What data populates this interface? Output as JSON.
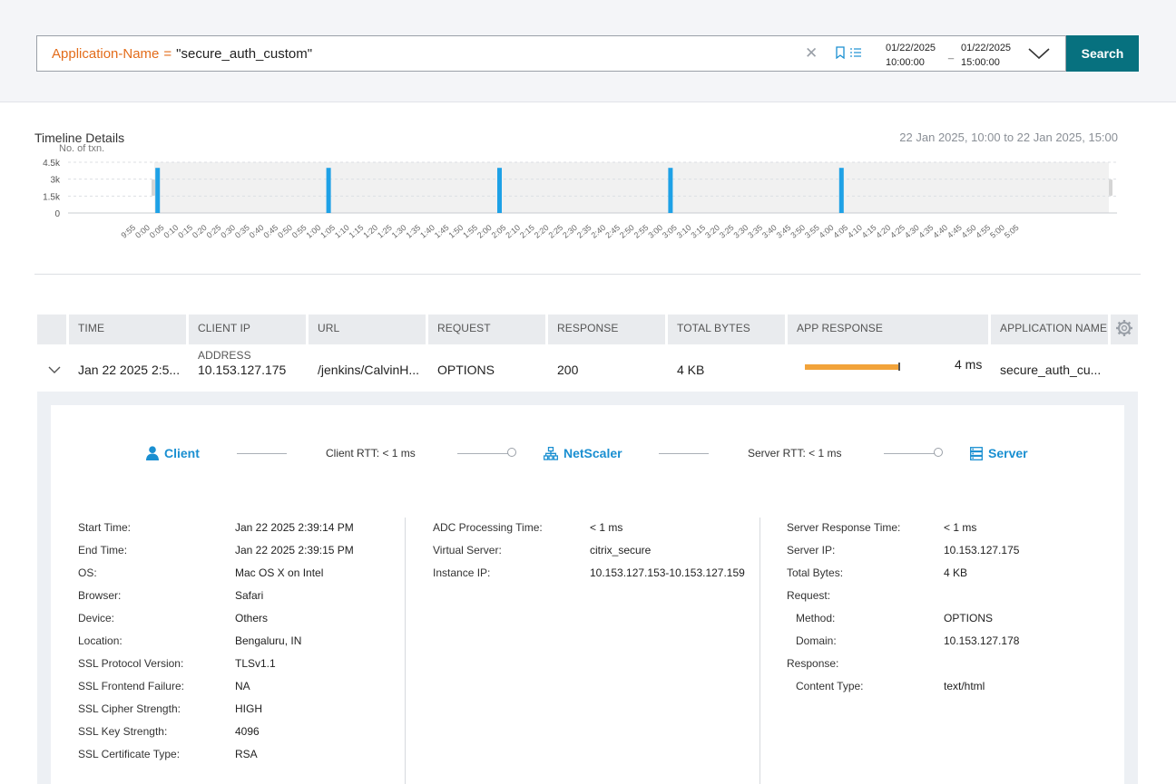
{
  "search": {
    "query_key": "Application-Name",
    "query_op": "=",
    "query_value": "\"secure_auth_custom\"",
    "clear_icon": "close-icon",
    "bookmark_icon": "bookmark-icon",
    "list_icon": "list-icon"
  },
  "date_range": {
    "from_date": "01/22/2025",
    "from_time": "10:00:00",
    "separator": "_",
    "to_date": "01/22/2025",
    "to_time": "15:00:00"
  },
  "search_button": "Search",
  "timeline": {
    "title": "Timeline Details",
    "range_label": "22 Jan 2025, 10:00 to 22 Jan 2025, 15:00"
  },
  "chart_data": {
    "type": "bar",
    "ylabel": "No. of txn.",
    "yticks": [
      "4.5k",
      "3k",
      "1.5k",
      "0"
    ],
    "ylim": [
      0,
      4500
    ],
    "xticks": [
      "9:55",
      "0:00",
      "0:05",
      "0:10",
      "0:15",
      "0:20",
      "0:25",
      "0:30",
      "0:35",
      "0:40",
      "0:45",
      "0:50",
      "0:55",
      "1:00",
      "1:05",
      "1:10",
      "1:15",
      "1:20",
      "1:25",
      "1:30",
      "1:35",
      "1:40",
      "1:45",
      "1:50",
      "1:55",
      "2:00",
      "2:05",
      "2:10",
      "2:15",
      "2:20",
      "2:25",
      "2:30",
      "2:35",
      "2:40",
      "2:45",
      "2:50",
      "2:55",
      "3:00",
      "3:05",
      "3:10",
      "3:15",
      "3:20",
      "3:25",
      "3:30",
      "3:35",
      "3:40",
      "3:45",
      "3:50",
      "3:55",
      "4:00",
      "4:05",
      "4:10",
      "4:15",
      "4:20",
      "4:25",
      "4:30",
      "4:35",
      "4:40",
      "4:45",
      "4:50",
      "4:55",
      "5:00",
      "5:05"
    ],
    "bars": [
      {
        "x": "10:00",
        "value": 4000
      },
      {
        "x": "11:00",
        "value": 4000
      },
      {
        "x": "12:00",
        "value": 4000
      },
      {
        "x": "13:00",
        "value": 4000
      },
      {
        "x": "14:00",
        "value": 4000
      }
    ],
    "color": "#1ea1e6",
    "grid": true
  },
  "table": {
    "columns": [
      "TIME",
      "CLIENT IP ADDRESS",
      "URL",
      "REQUEST",
      "RESPONSE",
      "TOTAL BYTES",
      "APP RESPONSE",
      "APPLICATION NAME"
    ],
    "settings_icon": "gear-icon",
    "row": {
      "time": "Jan 22 2025 2:5...",
      "client_ip": "10.153.127.175",
      "url": "/jenkins/CalvinH...",
      "request": "OPTIONS",
      "response": "200",
      "total_bytes": "4 KB",
      "app_response_ms": "4 ms",
      "app_response_fill": 1.0,
      "application_name": "secure_auth_cu...",
      "bar_color": "#f2a33a"
    }
  },
  "flow": {
    "client": "Client",
    "client_rtt": "Client RTT: < 1 ms",
    "netscaler": "NetScaler",
    "server_rtt": "Server RTT: < 1 ms",
    "server": "Server",
    "client_icon": "user-icon",
    "netscaler_icon": "network-icon",
    "server_icon": "server-icon"
  },
  "client_details": [
    {
      "k": "Start Time:",
      "v": "Jan 22 2025 2:39:14 PM"
    },
    {
      "k": "End Time:",
      "v": "Jan 22 2025 2:39:15 PM"
    },
    {
      "k": "OS:",
      "v": "Mac OS X on Intel"
    },
    {
      "k": "Browser:",
      "v": "Safari"
    },
    {
      "k": "Device:",
      "v": "Others"
    },
    {
      "k": "Location:",
      "v": "Bengaluru, IN"
    },
    {
      "k": "SSL Protocol Version:",
      "v": "TLSv1.1"
    },
    {
      "k": "SSL Frontend Failure:",
      "v": "NA"
    },
    {
      "k": "SSL Cipher Strength:",
      "v": "HIGH"
    },
    {
      "k": "SSL Key Strength:",
      "v": "4096"
    },
    {
      "k": "SSL Certificate Type:",
      "v": "RSA"
    }
  ],
  "adc_details": [
    {
      "k": "ADC Processing Time:",
      "v": "< 1 ms"
    },
    {
      "k": "Virtual Server:",
      "v": "citrix_secure"
    },
    {
      "k": "Instance IP:",
      "v": "10.153.127.153-10.153.127.159"
    }
  ],
  "server_details": [
    {
      "k": "Server Response Time:",
      "v": "< 1 ms"
    },
    {
      "k": "Server IP:",
      "v": "10.153.127.175"
    },
    {
      "k": "Total Bytes:",
      "v": "4 KB"
    },
    {
      "k": "Request:",
      "v": ""
    },
    {
      "k": "Method:",
      "v": "OPTIONS"
    },
    {
      "k": "Domain:",
      "v": "10.153.127.178"
    },
    {
      "k": "Response:",
      "v": ""
    },
    {
      "k": "Content Type:",
      "v": "text/html"
    }
  ]
}
